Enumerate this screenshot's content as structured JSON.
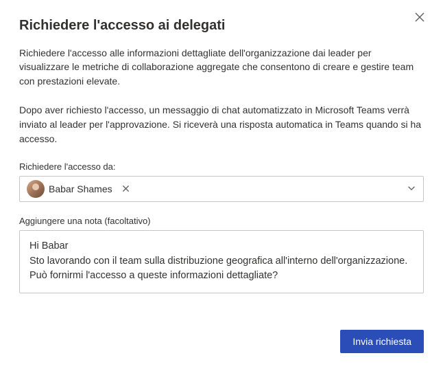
{
  "dialog": {
    "title": "Richiedere l'accesso ai delegati",
    "intro": "Richiedere l'accesso alle informazioni dettagliate dell'organizzazione dai leader per visualizzare le metriche di collaborazione aggregate che consentono di creare e gestire team con prestazioni elevate.",
    "after": "Dopo aver richiesto l'accesso, un messaggio di chat automatizzato in Microsoft Teams verrà inviato al leader per l'approvazione. Si riceverà una risposta automatica in Teams quando si ha accesso."
  },
  "request_from": {
    "label": "Richiedere l'accesso da:",
    "selected_person": {
      "name": "Babar Shames"
    }
  },
  "note": {
    "label": "Aggiungere una nota (facoltativo)",
    "value": "Hi Babar\nSto lavorando con il team sulla distribuzione geografica all'interno dell'organizzazione. Può fornirmi l'accesso a queste informazioni dettagliate?"
  },
  "buttons": {
    "submit": "Invia richiesta"
  },
  "icons": {
    "close": "close",
    "remove": "remove",
    "chevron_down": "chevron-down"
  }
}
